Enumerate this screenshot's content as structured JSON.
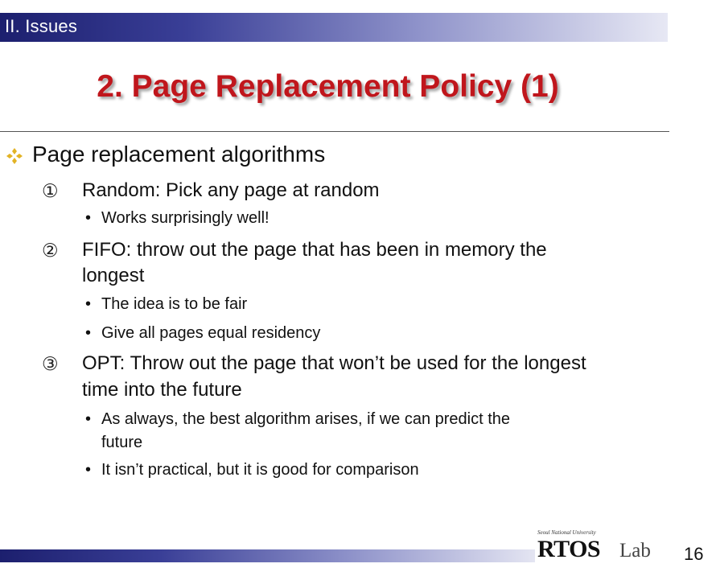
{
  "header": {
    "section": "II. Issues",
    "title": "2. Page Replacement Policy (1)"
  },
  "content": {
    "main_bullet": "Page replacement algorithms",
    "items": [
      {
        "number": "①",
        "lines": [
          "Random: Pick any page at random"
        ],
        "subs": [
          {
            "lines": [
              "Works surprisingly well!"
            ]
          }
        ]
      },
      {
        "number": "②",
        "lines": [
          "FIFO: throw out the page that has been in memory the",
          "longest"
        ],
        "subs": [
          {
            "lines": [
              "The idea is to be fair"
            ]
          },
          {
            "lines": [
              "Give all pages equal residency"
            ]
          }
        ]
      },
      {
        "number": "③",
        "lines": [
          "OPT: Throw out the page that won’t be used for the longest",
          "time into the future"
        ],
        "subs": [
          {
            "lines": [
              "As always, the best algorithm arises, if we can predict the",
              "future"
            ]
          },
          {
            "lines": [
              "It isn’t practical, but it is good for comparison"
            ]
          }
        ]
      }
    ]
  },
  "footer": {
    "university": "Seoul National University",
    "logo": "RTOS",
    "logo_suffix": "Lab",
    "page_number": "16"
  },
  "colors": {
    "bar_dark": "#1c1f6e",
    "title_red": "#c0161c",
    "diamond_yellow": "#e2b325"
  },
  "icons": {
    "main_bullet": "diamond-bullet-icon",
    "sub_bullet": "dot-bullet-icon"
  }
}
